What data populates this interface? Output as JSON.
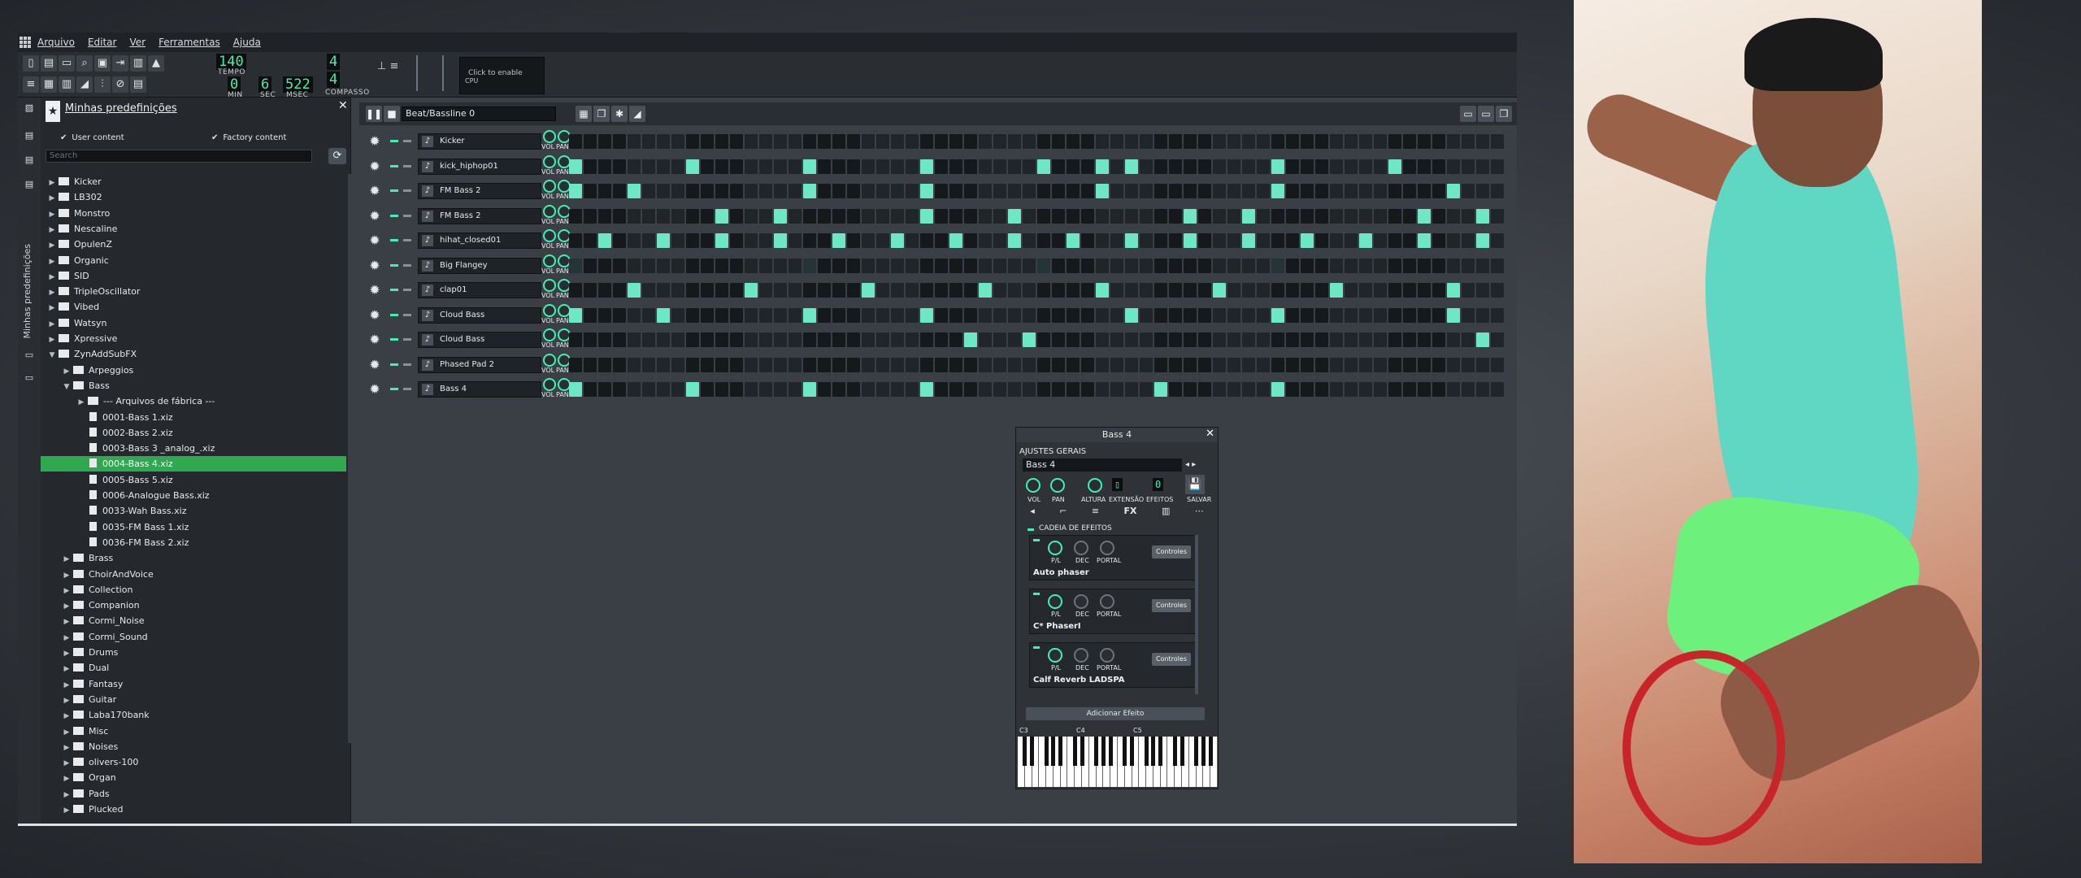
{
  "menu": [
    "Arquivo",
    "Editar",
    "Ver",
    "Ferramentas",
    "Ajuda"
  ],
  "toolbar": {
    "tempo_value": "140",
    "tempo_label": "TEMPO",
    "time_min": "0",
    "time_sec": "6",
    "time_msec": "522",
    "min_label": "MIN",
    "sec_label": "SEC",
    "msec_label": "MSEC",
    "sig_num": "4",
    "sig_den": "4",
    "sig_label": "COMPASSO",
    "cpu_click": "Click to enable",
    "cpu_label": "CPU"
  },
  "sidebar": {
    "vertical_label": "Minhas predefinições"
  },
  "browser": {
    "title": "Minhas predefinições",
    "user_content": "User content",
    "factory_content": "Factory content",
    "search_placeholder": "Search",
    "items": [
      {
        "label": "Kicker",
        "type": "folder",
        "level": 0,
        "open": false
      },
      {
        "label": "LB302",
        "type": "folder",
        "level": 0,
        "open": false
      },
      {
        "label": "Monstro",
        "type": "folder",
        "level": 0,
        "open": false
      },
      {
        "label": "Nescaline",
        "type": "folder",
        "level": 0,
        "open": false
      },
      {
        "label": "OpulenZ",
        "type": "folder",
        "level": 0,
        "open": false
      },
      {
        "label": "Organic",
        "type": "folder",
        "level": 0,
        "open": false
      },
      {
        "label": "SID",
        "type": "folder",
        "level": 0,
        "open": false
      },
      {
        "label": "TripleOscillator",
        "type": "folder",
        "level": 0,
        "open": false
      },
      {
        "label": "Vibed",
        "type": "folder",
        "level": 0,
        "open": false
      },
      {
        "label": "Watsyn",
        "type": "folder",
        "level": 0,
        "open": false
      },
      {
        "label": "Xpressive",
        "type": "folder",
        "level": 0,
        "open": false
      },
      {
        "label": "ZynAddSubFX",
        "type": "folder",
        "level": 0,
        "open": true
      },
      {
        "label": "Arpeggios",
        "type": "folder",
        "level": 1,
        "open": false
      },
      {
        "label": "Bass",
        "type": "folder",
        "level": 1,
        "open": true
      },
      {
        "label": "--- Arquivos de fábrica ---",
        "type": "folder",
        "level": 2,
        "open": false
      },
      {
        "label": "0001-Bass 1.xiz",
        "type": "file",
        "level": 2
      },
      {
        "label": "0002-Bass 2.xiz",
        "type": "file",
        "level": 2
      },
      {
        "label": "0003-Bass 3 _analog_.xiz",
        "type": "file",
        "level": 2
      },
      {
        "label": "0004-Bass 4.xiz",
        "type": "file",
        "level": 2,
        "selected": true
      },
      {
        "label": "0005-Bass 5.xiz",
        "type": "file",
        "level": 2
      },
      {
        "label": "0006-Analogue Bass.xiz",
        "type": "file",
        "level": 2
      },
      {
        "label": "0033-Wah Bass.xiz",
        "type": "file",
        "level": 2
      },
      {
        "label": "0035-FM Bass 1.xiz",
        "type": "file",
        "level": 2
      },
      {
        "label": "0036-FM Bass 2.xiz",
        "type": "file",
        "level": 2
      },
      {
        "label": "Brass",
        "type": "folder",
        "level": 1,
        "open": false
      },
      {
        "label": "ChoirAndVoice",
        "type": "folder",
        "level": 1,
        "open": false
      },
      {
        "label": "Collection",
        "type": "folder",
        "level": 1,
        "open": false
      },
      {
        "label": "Companion",
        "type": "folder",
        "level": 1,
        "open": false
      },
      {
        "label": "Cormi_Noise",
        "type": "folder",
        "level": 1,
        "open": false
      },
      {
        "label": "Cormi_Sound",
        "type": "folder",
        "level": 1,
        "open": false
      },
      {
        "label": "Drums",
        "type": "folder",
        "level": 1,
        "open": false
      },
      {
        "label": "Dual",
        "type": "folder",
        "level": 1,
        "open": false
      },
      {
        "label": "Fantasy",
        "type": "folder",
        "level": 1,
        "open": false
      },
      {
        "label": "Guitar",
        "type": "folder",
        "level": 1,
        "open": false
      },
      {
        "label": "Laba170bank",
        "type": "folder",
        "level": 1,
        "open": false
      },
      {
        "label": "Misc",
        "type": "folder",
        "level": 1,
        "open": false
      },
      {
        "label": "Noises",
        "type": "folder",
        "level": 1,
        "open": false
      },
      {
        "label": "olivers-100",
        "type": "folder",
        "level": 1,
        "open": false
      },
      {
        "label": "Organ",
        "type": "folder",
        "level": 1,
        "open": false
      },
      {
        "label": "Pads",
        "type": "folder",
        "level": 1,
        "open": false
      },
      {
        "label": "Plucked",
        "type": "folder",
        "level": 1,
        "open": false
      }
    ]
  },
  "beat": {
    "selector": "Beat/Bassline 0",
    "vol_label": "VOL",
    "pan_label": "PAN",
    "tracks": [
      {
        "name": "Kicker",
        "icon": "kicker-icon",
        "steps": ""
      },
      {
        "name": "kick_hiphop01",
        "icon": "note-icon",
        "steps": "1000000010000000100000001000000010001010000000001000000010000000100010"
      },
      {
        "name": "FM Bass 2",
        "icon": "zyn-icon",
        "steps": "1000100000000000100000001000000000001000000000001000000000001000000000"
      },
      {
        "name": "FM Bass 2",
        "icon": "zyn-icon",
        "steps": "0000000000100010000000001000001000000000001000100000000000100010000000"
      },
      {
        "name": "hihat_closed01",
        "icon": "note-icon",
        "steps": "0010001000100010001000100010001000100010001000100010001000100010001010"
      },
      {
        "name": "Big Flangey",
        "icon": "zyn-icon",
        "steps": "d000000000000000d000000000000000d000000000000000d000000000000000000000"
      },
      {
        "name": "clap01",
        "icon": "note-icon",
        "steps": "0000100000001000000010000000100000001000000010000000100000001000000000"
      },
      {
        "name": "Cloud Bass",
        "icon": "synth-icon",
        "steps": "1000001000000000100000001000000000000010000000001000000000001000000000"
      },
      {
        "name": "Cloud Bass",
        "icon": "synth-icon",
        "steps": "0000000000000000000000000001000100000000000000000000000000000010000100"
      },
      {
        "name": "Phased Pad 2",
        "icon": "zyn-icon",
        "steps": "0000000000000000000000000000000000000000000000000000000000000000000000"
      },
      {
        "name": "Bass 4",
        "icon": "zyn-icon",
        "steps": "1000000010000000100000001000000000000000100000001000000000000000000000"
      }
    ]
  },
  "fxwin": {
    "title": "Bass 4",
    "section": "AJUSTES GERAIS",
    "name": "Bass 4",
    "vol": "VOL",
    "pan": "PAN",
    "pitch": "ALTURA",
    "range": "EXTENSÃO",
    "fxch_num": "0",
    "fx_label": "EFEITOS",
    "save": "SALVAR",
    "fx_tab": "FX",
    "chain": "CADEIA DE EFEITOS",
    "effects": [
      {
        "name": "Auto phaser",
        "p1": "P/L",
        "p2": "DEC",
        "p3": "PORTAL",
        "ctl": "Controles"
      },
      {
        "name": "C* PhaserI",
        "p1": "P/L",
        "p2": "DEC",
        "p3": "PORTAL",
        "ctl": "Controles"
      },
      {
        "name": "Calf Reverb LADSPA",
        "p1": "P/L",
        "p2": "DEC",
        "p3": "PORTAL",
        "ctl": "Controles"
      }
    ],
    "add_effect": "Adicionar Efeito",
    "keys": [
      "C3",
      "C4",
      "C5"
    ]
  },
  "colors": {
    "accent": "#3df2b0",
    "step_on": "#6ee8c4",
    "selection": "#2fa84f"
  }
}
